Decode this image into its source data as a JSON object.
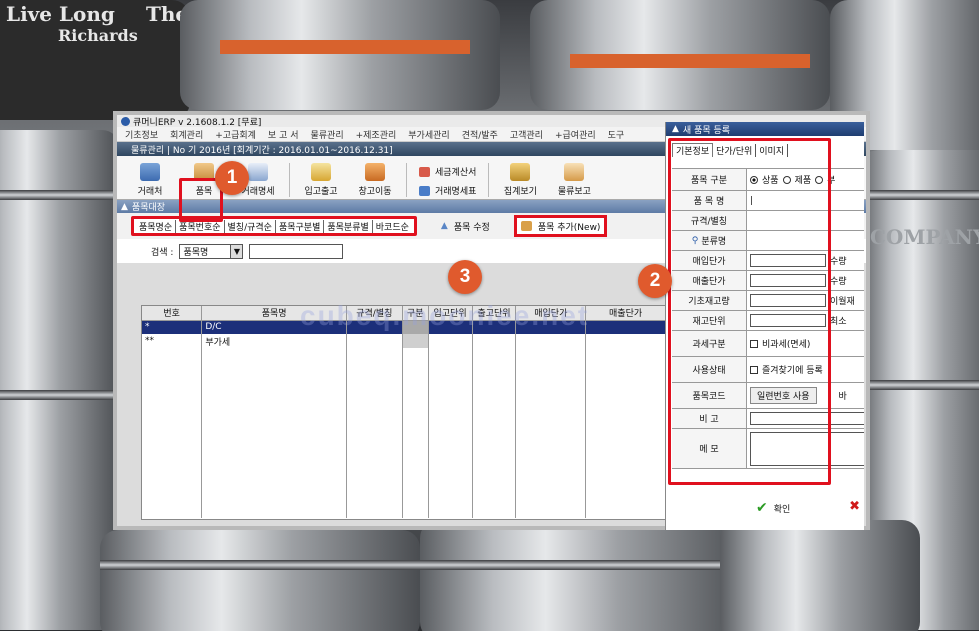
{
  "background": {
    "texts": [
      "Live Long",
      "The",
      "Richards",
      "COMPANY"
    ]
  },
  "window": {
    "title": "큐머니ERP  v 2.1608.1.2 [무료]",
    "menu": [
      "기초정보",
      "회계관리",
      "+고급회계",
      "보 고 서",
      "물류관리",
      "+제조관리",
      "부가세관리",
      "견적/발주",
      "고객관리",
      "+급여관리",
      "도구"
    ],
    "subtitle": "물류관리 | No     기 2016년 [회계기간 : 2016.01.01~2016.12.31]",
    "toolbar": {
      "buttons": [
        "거래처",
        "품목",
        "거래명세",
        "입고출고",
        "창고이동",
        "집계보기",
        "물류보고"
      ],
      "pair": [
        "세금계산서",
        "거래명세표"
      ]
    },
    "panel_title": "품목대장",
    "tabs": [
      "품목명순",
      "품목번호순",
      "별칭/규격순",
      "품목구분별",
      "품목분류별",
      "바코드순"
    ],
    "edit_label": "품목 수정",
    "add_label": "품목 추가(New)",
    "search": {
      "label": "검색 :",
      "selected": "품목명"
    },
    "grid": {
      "headers": [
        "번호",
        "품목명",
        "규격/별칭",
        "구분",
        "입고단위",
        "출고단위",
        "매입단가",
        "매출단가"
      ],
      "rows": [
        [
          "*",
          "D/C",
          "",
          "",
          "",
          "",
          "",
          ""
        ],
        [
          "**",
          "부가세",
          "",
          "",
          "",
          "",
          "",
          ""
        ]
      ]
    }
  },
  "dialog": {
    "title": "새 품목 등록",
    "tabs": [
      "기본정보",
      "단가/단위",
      "이미지"
    ],
    "fields": {
      "item_type_label": "품목 구분",
      "item_type_options": [
        "상품",
        "제품",
        "부"
      ],
      "item_name_label": "품 목 명",
      "spec_label": "규격/별칭",
      "category_label": "분류명",
      "purchase_price_label": "매입단가",
      "sale_price_label": "매출단가",
      "qty_label": "수량",
      "stock_label": "기초재고량",
      "carryover_label": "이월재",
      "stock_unit_label": "재고단위",
      "min_label": "최소",
      "tax_label": "과세구분",
      "tax_option": "비과세(면세)",
      "status_label": "사용상태",
      "status_option": "즐겨찾기에 등록",
      "code_label": "품목코드",
      "code_button": "일련번호 사용",
      "code_extra": "바",
      "note_label": "비  고",
      "memo_label": "메  모"
    },
    "confirm_label": "확인"
  },
  "markers": [
    "1",
    "2",
    "3"
  ],
  "watermark": "cubeq.mooniee.net",
  "colors": {
    "highlight": "#e0101e",
    "marker": "#e05a2d",
    "selected_row": "#1c2f7a"
  }
}
